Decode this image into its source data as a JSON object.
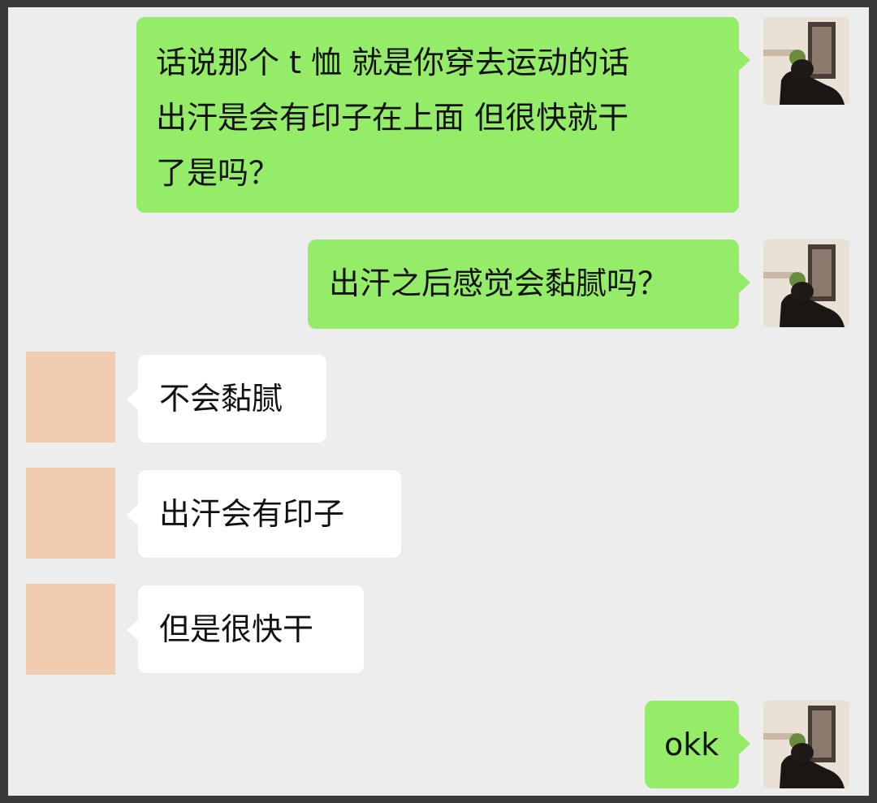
{
  "messages": [
    {
      "side": "out",
      "lines": [
        "话说那个 t 恤 就是你穿去运动的话",
        "出汗是会有印子在上面 但很快就干",
        "了是吗？"
      ]
    },
    {
      "side": "out",
      "text": "出汗之后感觉会黏腻吗？"
    },
    {
      "side": "in",
      "text": "不会黏腻"
    },
    {
      "side": "in",
      "text": "出汗会有印子"
    },
    {
      "side": "in",
      "text": "但是很快干"
    },
    {
      "side": "out",
      "text": "okk"
    }
  ],
  "colors": {
    "background": "#ededed",
    "outgoing_bubble": "#95ec69",
    "incoming_bubble": "#ffffff",
    "peer_avatar_redacted": "#f1ccb1"
  },
  "avatars": {
    "self": "user-photo-avatar",
    "peer": "redacted-avatar"
  }
}
